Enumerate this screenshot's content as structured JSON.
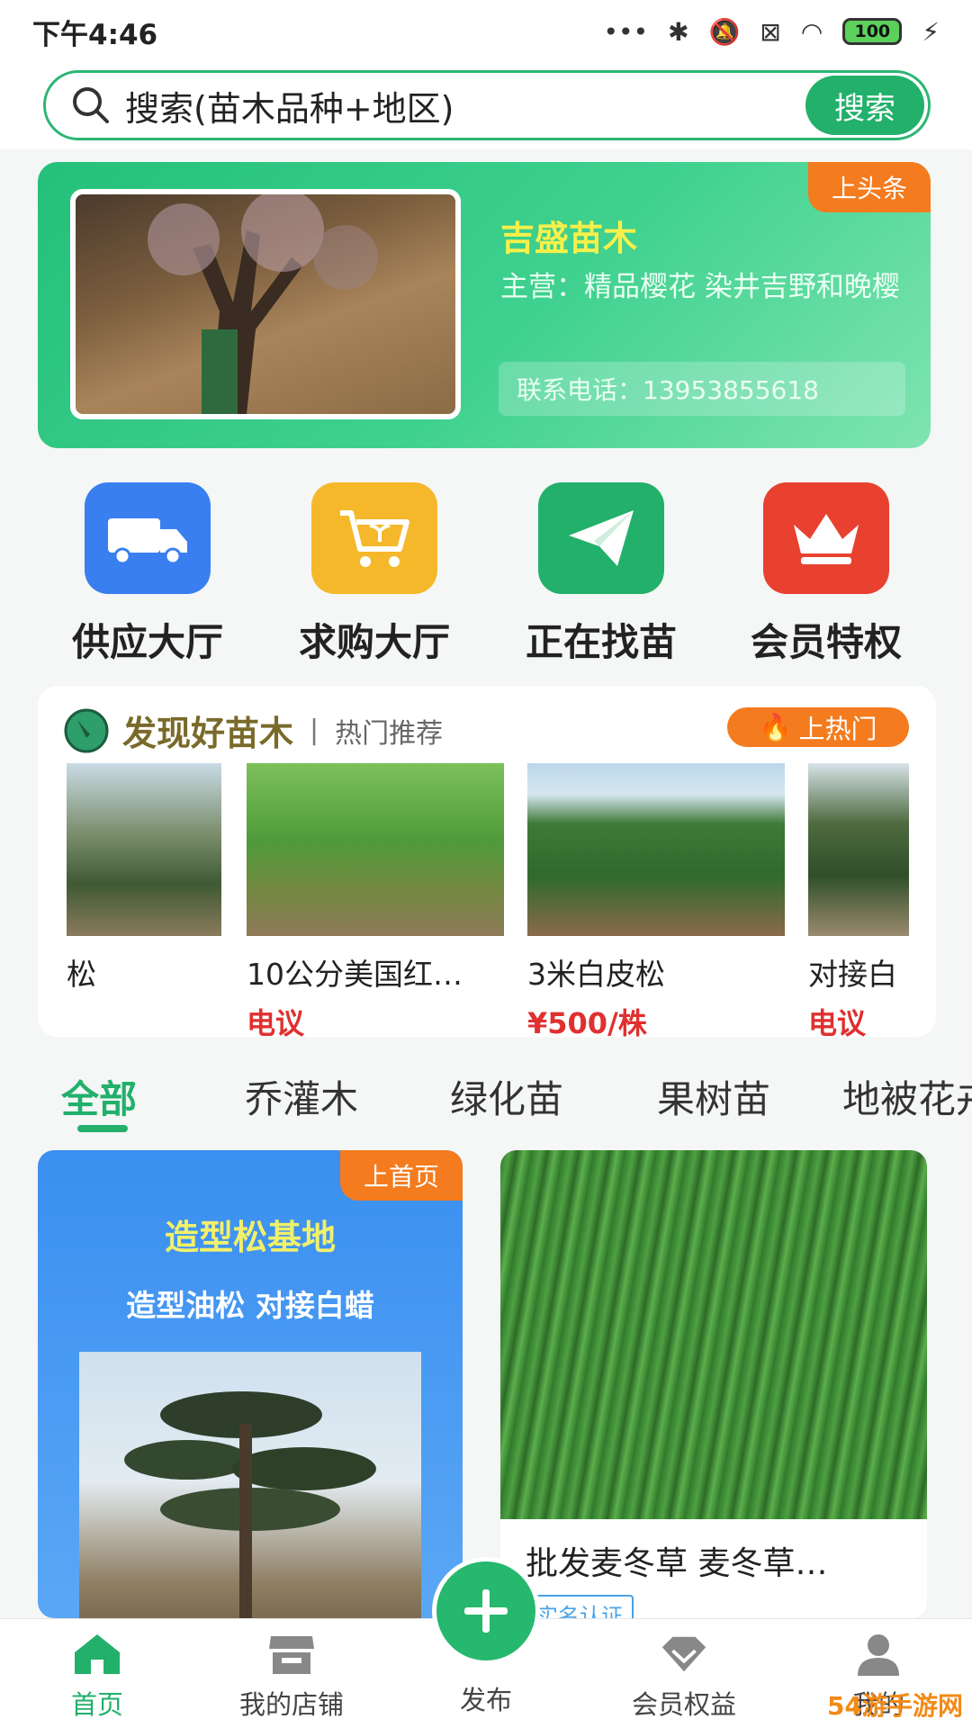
{
  "status_bar": {
    "time": "下午4:46",
    "battery": "100"
  },
  "search": {
    "placeholder": "搜索(苗木品种+地区)",
    "button": "搜索"
  },
  "banner": {
    "tag": "上头条",
    "name": "吉盛苗木",
    "main": "主营：精品樱花 染井吉野和晚樱",
    "phone": "联系电话：13953855618"
  },
  "quick_nav": [
    {
      "label": "供应大厅",
      "icon": "truck-icon",
      "color": "#3a7ff0"
    },
    {
      "label": "求购大厅",
      "icon": "cart-icon",
      "color": "#f5b82a"
    },
    {
      "label": "正在找苗",
      "icon": "paper-plane-icon",
      "color": "#22b06b"
    },
    {
      "label": "会员特权",
      "icon": "crown-icon",
      "color": "#e8412f"
    }
  ],
  "discover": {
    "title": "发现好苗木",
    "subtitle": "热门推荐",
    "hot_button": "上热门",
    "items": [
      {
        "name": "松",
        "price": ""
      },
      {
        "name": "10公分美国红…",
        "price": "电议"
      },
      {
        "name": "3米白皮松",
        "price": "¥500/株"
      },
      {
        "name": "对接白",
        "price": "电议"
      }
    ]
  },
  "tabs": [
    "全部",
    "乔灌木",
    "绿化苗",
    "果树苗",
    "地被花卉"
  ],
  "feed": {
    "left": {
      "tag": "上首页",
      "title": "造型松基地",
      "subtitle": "造型油松 对接白蜡"
    },
    "right": {
      "title": "批发麦冬草 麦冬草…",
      "badge": "实名认证"
    }
  },
  "bottom_nav": {
    "home": "首页",
    "shop": "我的店铺",
    "publish": "发布",
    "member": "会员权益",
    "profile": "我的"
  },
  "watermark": "54游手游网",
  "colors": {
    "primary": "#22b06b",
    "accent": "#f47b1e",
    "price": "#e03030"
  }
}
